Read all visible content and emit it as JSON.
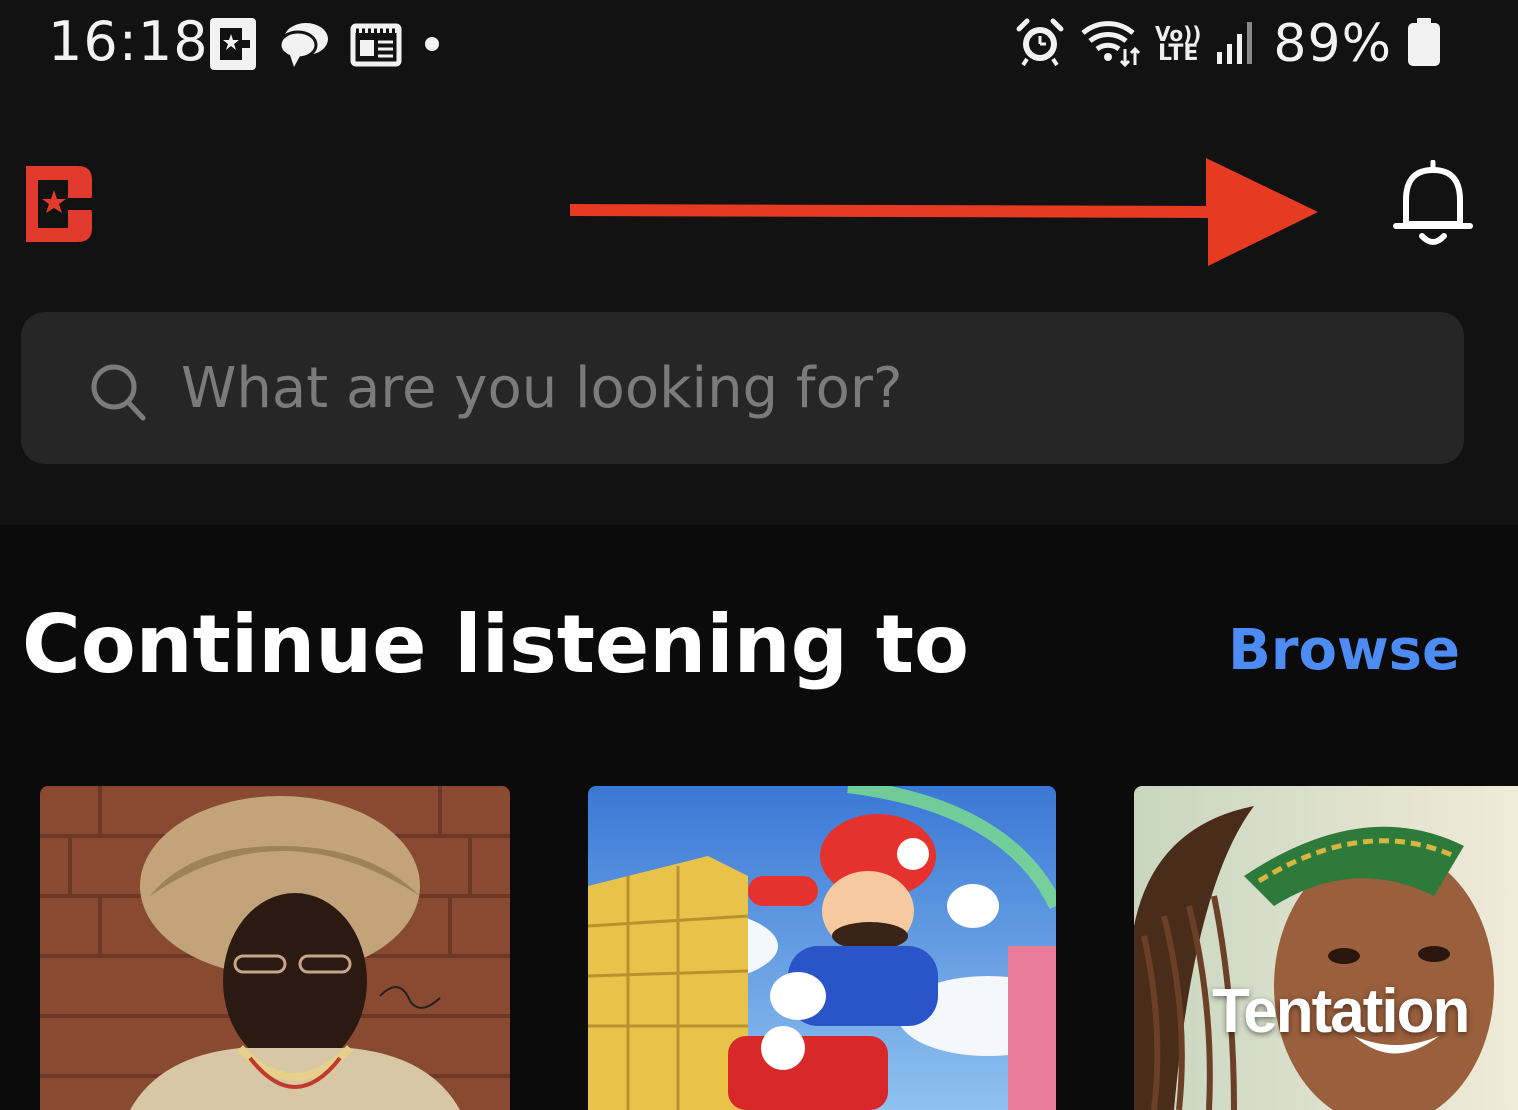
{
  "status_bar": {
    "time": "16:18",
    "left_icons": [
      "app-b-icon",
      "chat-bubble-icon",
      "calendar-news-icon",
      "dot-icon"
    ],
    "right_icons": [
      "alarm-icon",
      "wifi-icon",
      "volte-icon",
      "signal-icon",
      "battery-icon"
    ],
    "volte_top": "Vo))",
    "volte_bottom": "LTE",
    "battery_percent": "89%"
  },
  "header": {
    "logo": "app-logo-icon",
    "annotation": "red-arrow-pointing-right",
    "notifications_icon": "bell-icon"
  },
  "search": {
    "placeholder": "What are you looking for?",
    "value": "",
    "icon": "search-icon"
  },
  "section": {
    "title": "Continue listening to",
    "browse_label": "Browse"
  },
  "cards": [
    {
      "image": "portrait-woman-headwrap"
    },
    {
      "image": "mario-flying-artwork"
    },
    {
      "image": "smiling-woman-braids",
      "overlay_text": "Tentation"
    }
  ],
  "colors": {
    "background": "#0b0b0b",
    "header_background": "#121212",
    "search_background": "#262626",
    "placeholder": "#7b7b7b",
    "accent_link": "#4d8cf5",
    "logo_red": "#e23a2d",
    "arrow_red": "#e63a22"
  }
}
